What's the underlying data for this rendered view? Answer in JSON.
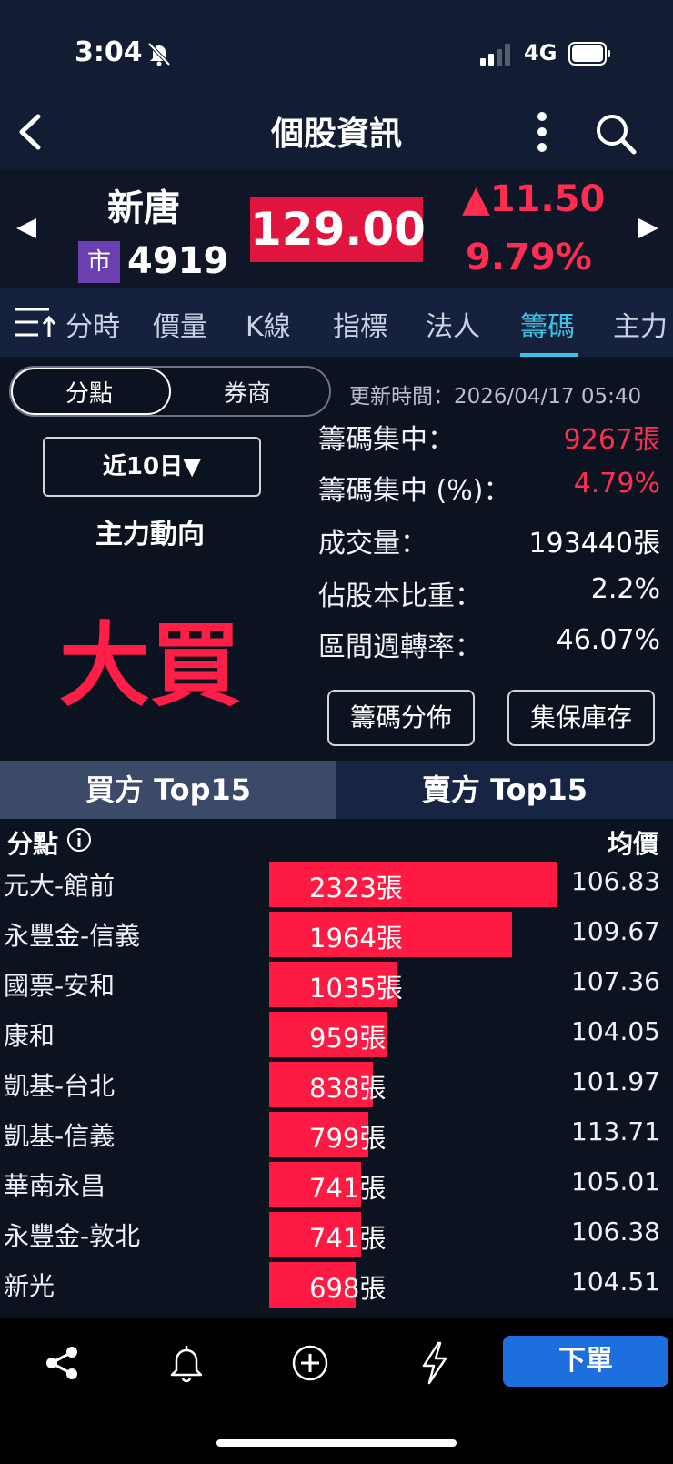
{
  "status": {
    "time": "3:04",
    "network": "4G"
  },
  "nav": {
    "title": "個股資訊"
  },
  "stock": {
    "name": "新唐",
    "market": "市",
    "code": "4919",
    "price": "129.00",
    "change": "▲11.50",
    "change_pct": "9.79%"
  },
  "tabs": [
    "分時",
    "價量",
    "K線",
    "指標",
    "法人",
    "籌碼",
    "主力"
  ],
  "active_tab": "籌碼",
  "segment": {
    "branch": "分點",
    "broker": "券商"
  },
  "update_time": "更新時間：2026/04/17 05:40",
  "range_button": "近10日▼",
  "direction": {
    "label": "主力動向",
    "value": "大買"
  },
  "stats": [
    {
      "label": "籌碼集中：",
      "value": "9267張",
      "highlight": true
    },
    {
      "label": "籌碼集中 (%)：",
      "value": "4.79%",
      "highlight": true
    },
    {
      "label": "成交量：",
      "value": "193440張",
      "highlight": false
    },
    {
      "label": "佔股本比重：",
      "value": "2.2%",
      "highlight": false
    },
    {
      "label": "區間週轉率：",
      "value": "46.07%",
      "highlight": false
    }
  ],
  "buttons": {
    "distribution": "籌碼分佈",
    "tdcc": "集保庫存"
  },
  "top_tabs": {
    "buy": "買方 Top15",
    "sell": "賣方 Top15"
  },
  "table": {
    "header_branch": "分點",
    "header_avg": "均價",
    "rows": [
      {
        "name": "元大-館前",
        "volume": "2323張",
        "volume_num": 2323,
        "avg": "106.83"
      },
      {
        "name": "永豐金-信義",
        "volume": "1964張",
        "volume_num": 1964,
        "avg": "109.67"
      },
      {
        "name": "國票-安和",
        "volume": "1035張",
        "volume_num": 1035,
        "avg": "107.36"
      },
      {
        "name": "康和",
        "volume": "959張",
        "volume_num": 959,
        "avg": "104.05"
      },
      {
        "name": "凱基-台北",
        "volume": "838張",
        "volume_num": 838,
        "avg": "101.97"
      },
      {
        "name": "凱基-信義",
        "volume": "799張",
        "volume_num": 799,
        "avg": "113.71"
      },
      {
        "name": "華南永昌",
        "volume": "741張",
        "volume_num": 741,
        "avg": "105.01"
      },
      {
        "name": "永豐金-敦北",
        "volume": "741張",
        "volume_num": 741,
        "avg": "106.38"
      },
      {
        "name": "新光",
        "volume": "698張",
        "volume_num": 698,
        "avg": "104.51"
      }
    ]
  },
  "toolbar": {
    "order": "下單"
  },
  "colors": {
    "up": "#ff2d4f",
    "accent": "#3ec3e8",
    "order": "#1d6fe0",
    "bar": "#ff1a43"
  },
  "icons": [
    "bell-off-icon",
    "signal-icon",
    "battery-icon",
    "back-icon",
    "more-icon",
    "search-icon",
    "prev-arrow-icon",
    "next-arrow-icon",
    "tab-menu-icon",
    "info-icon",
    "share-icon",
    "bell-icon",
    "add-icon",
    "flash-icon"
  ]
}
